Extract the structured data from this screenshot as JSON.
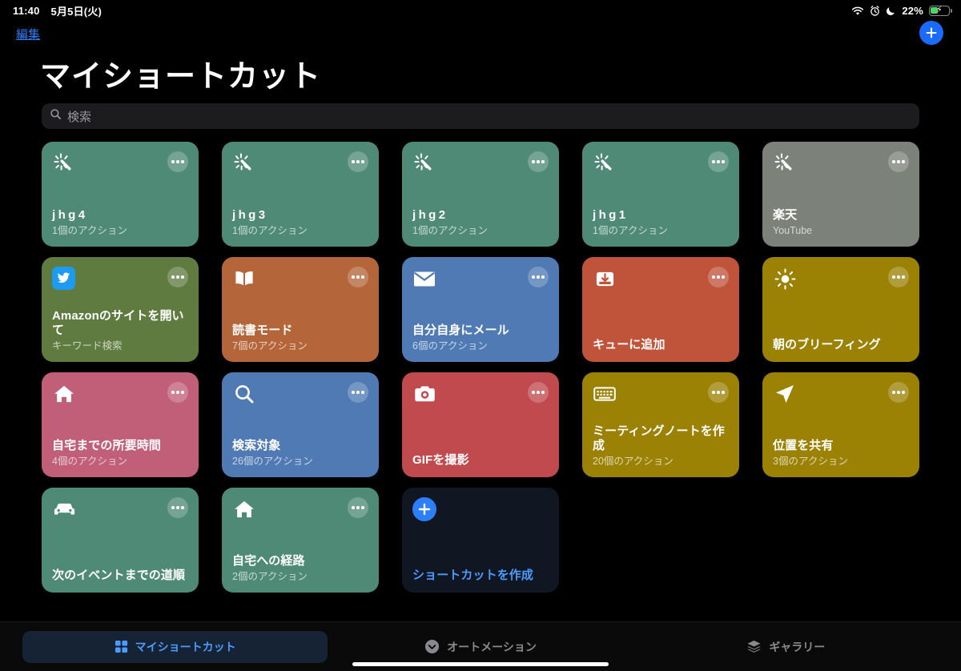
{
  "status_bar": {
    "time": "11:40",
    "date": "5月5日(火)",
    "wifi_icon": "wifi-icon",
    "alarm_icon": "alarm-clock-icon",
    "dnd_icon": "moon-icon",
    "battery_percent": "22%",
    "battery_charging": true
  },
  "nav": {
    "edit_label": "編集",
    "add_icon": "plus-icon"
  },
  "header": {
    "title": "マイショートカット"
  },
  "search": {
    "placeholder": "検索",
    "icon": "search-icon"
  },
  "colors": {
    "accent_blue": "#1a6bff",
    "tab_active": "#4c9bff",
    "background": "#000000",
    "search_field": "#1c1c1e"
  },
  "shortcuts": [
    {
      "title": "jhg4",
      "subtitle": "1個のアクション",
      "icon": "magic-wand-icon",
      "color": "#4f8a76",
      "spaced": true
    },
    {
      "title": "jhg3",
      "subtitle": "1個のアクション",
      "icon": "magic-wand-icon",
      "color": "#4f8a76",
      "spaced": true
    },
    {
      "title": "jhg2",
      "subtitle": "1個のアクション",
      "icon": "magic-wand-icon",
      "color": "#4f8a76",
      "spaced": true
    },
    {
      "title": "jhg1",
      "subtitle": "1個のアクション",
      "icon": "magic-wand-icon",
      "color": "#4f8a76",
      "spaced": true
    },
    {
      "title": "楽天",
      "subtitle": "YouTube",
      "icon": "magic-wand-icon",
      "color": "#7c8279",
      "spaced": false
    },
    {
      "title": "Amazonのサイトを開いて",
      "subtitle": "キーワード検索",
      "icon": "twitter-icon",
      "color": "#5f7b40",
      "spaced": false
    },
    {
      "title": "読書モード",
      "subtitle": "7個のアクション",
      "icon": "book-icon",
      "color": "#b4663a",
      "spaced": false
    },
    {
      "title": "自分自身にメール",
      "subtitle": "6個のアクション",
      "icon": "envelope-icon",
      "color": "#4f7ab4",
      "spaced": false
    },
    {
      "title": "キューに追加",
      "subtitle": "",
      "icon": "download-tray-icon",
      "color": "#c0543a",
      "spaced": false
    },
    {
      "title": "朝のブリーフィング",
      "subtitle": "",
      "icon": "sun-icon",
      "color": "#9b8205",
      "spaced": false
    },
    {
      "title": "自宅までの所要時間",
      "subtitle": "4個のアクション",
      "icon": "house-icon",
      "color": "#c05f77",
      "spaced": false
    },
    {
      "title": "検索対象",
      "subtitle": "26個のアクション",
      "icon": "search-icon",
      "color": "#4f7ab4",
      "spaced": false
    },
    {
      "title": "GIFを撮影",
      "subtitle": "",
      "icon": "camera-icon",
      "color": "#c04a4e",
      "spaced": false
    },
    {
      "title": "ミーティングノートを作成",
      "subtitle": "20個のアクション",
      "icon": "keyboard-icon",
      "color": "#9b8205",
      "spaced": false
    },
    {
      "title": "位置を共有",
      "subtitle": "3個のアクション",
      "icon": "location-arrow-icon",
      "color": "#9b8205",
      "spaced": false
    },
    {
      "title": "次のイベントまでの道順",
      "subtitle": "",
      "icon": "car-icon",
      "color": "#4f8a76",
      "spaced": false
    },
    {
      "title": "自宅への経路",
      "subtitle": "2個のアクション",
      "icon": "house-icon",
      "color": "#4f8a76",
      "spaced": false
    }
  ],
  "create_tile": {
    "title": "ショートカットを作成",
    "icon": "plus-circle-icon"
  },
  "tabs": [
    {
      "label": "マイショートカット",
      "icon": "grid-icon",
      "active": true
    },
    {
      "label": "オートメーション",
      "icon": "automation-clock-icon",
      "active": false
    },
    {
      "label": "ギャラリー",
      "icon": "layers-icon",
      "active": false
    }
  ]
}
